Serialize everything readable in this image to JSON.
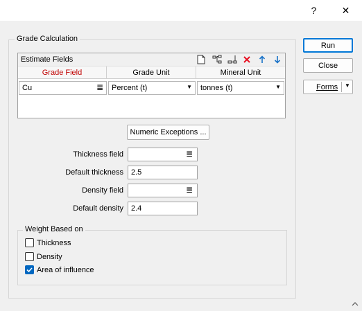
{
  "window": {
    "help_glyph": "?",
    "close_glyph": "✕"
  },
  "grade_calc": {
    "group_title": "Grade Calculation",
    "estimate_fields": {
      "title": "Estimate Fields",
      "toolbar": [
        "new-icon",
        "tree-icon",
        "insert-icon",
        "delete-icon",
        "up-arrow-icon",
        "down-arrow-icon"
      ],
      "columns": [
        "Grade Field",
        "Grade Unit",
        "Mineral Unit"
      ],
      "rows": [
        {
          "grade_field": "Cu",
          "grade_unit": "Percent (t)",
          "mineral_unit": "tonnes (t)"
        }
      ]
    },
    "numeric_exceptions_label": "Numeric Exceptions ...",
    "thickness_field_label": "Thickness field",
    "thickness_field_value": "",
    "default_thickness_label": "Default thickness",
    "default_thickness_value": "2.5",
    "density_field_label": "Density field",
    "density_field_value": "",
    "default_density_label": "Default density",
    "default_density_value": "2.4"
  },
  "weight": {
    "group_title": "Weight Based on",
    "options": [
      {
        "label": "Thickness",
        "checked": false
      },
      {
        "label": "Density",
        "checked": false
      },
      {
        "label": "Area of influence",
        "checked": true
      }
    ]
  },
  "buttons": {
    "run": "Run",
    "close": "Close",
    "forms": "Forms"
  },
  "colors": {
    "accent": "#0078d7",
    "required_header": "#c00000",
    "delete_icon": "#e81123",
    "arrow_icon": "#1a73c8"
  }
}
